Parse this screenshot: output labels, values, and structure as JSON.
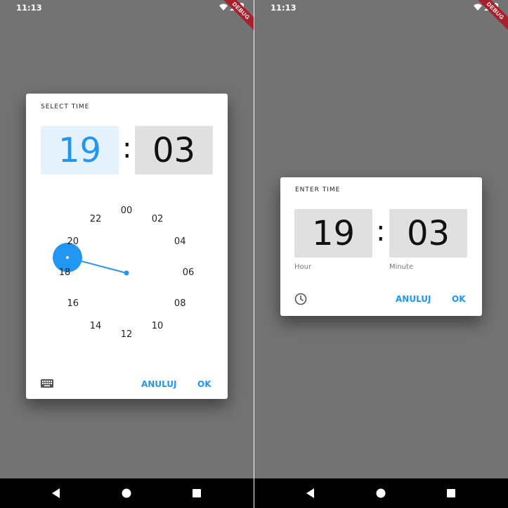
{
  "status_bar": {
    "time": "11:13",
    "debug_banner": "DEBUG"
  },
  "left_dialog": {
    "title": "SELECT TIME",
    "hour": "19",
    "separator": ":",
    "minute": "03",
    "dial_numbers": [
      "00",
      "02",
      "04",
      "06",
      "08",
      "10",
      "12",
      "14",
      "16",
      "18",
      "20",
      "22"
    ],
    "cancel_label": "ANULUJ",
    "ok_label": "OK",
    "mode_icon": "keyboard-icon"
  },
  "right_dialog": {
    "title": "ENTER TIME",
    "hour": "19",
    "separator": ":",
    "minute": "03",
    "hour_caption": "Hour",
    "minute_caption": "Minute",
    "cancel_label": "ANULUJ",
    "ok_label": "OK",
    "mode_icon": "clock-icon"
  },
  "colors": {
    "accent": "#2196f3",
    "selected_box": "#e3f2fd",
    "unselected_box": "#e0e0e0",
    "scrim": "#737373"
  },
  "nav_icons": [
    "back-icon",
    "home-icon",
    "recents-icon"
  ]
}
